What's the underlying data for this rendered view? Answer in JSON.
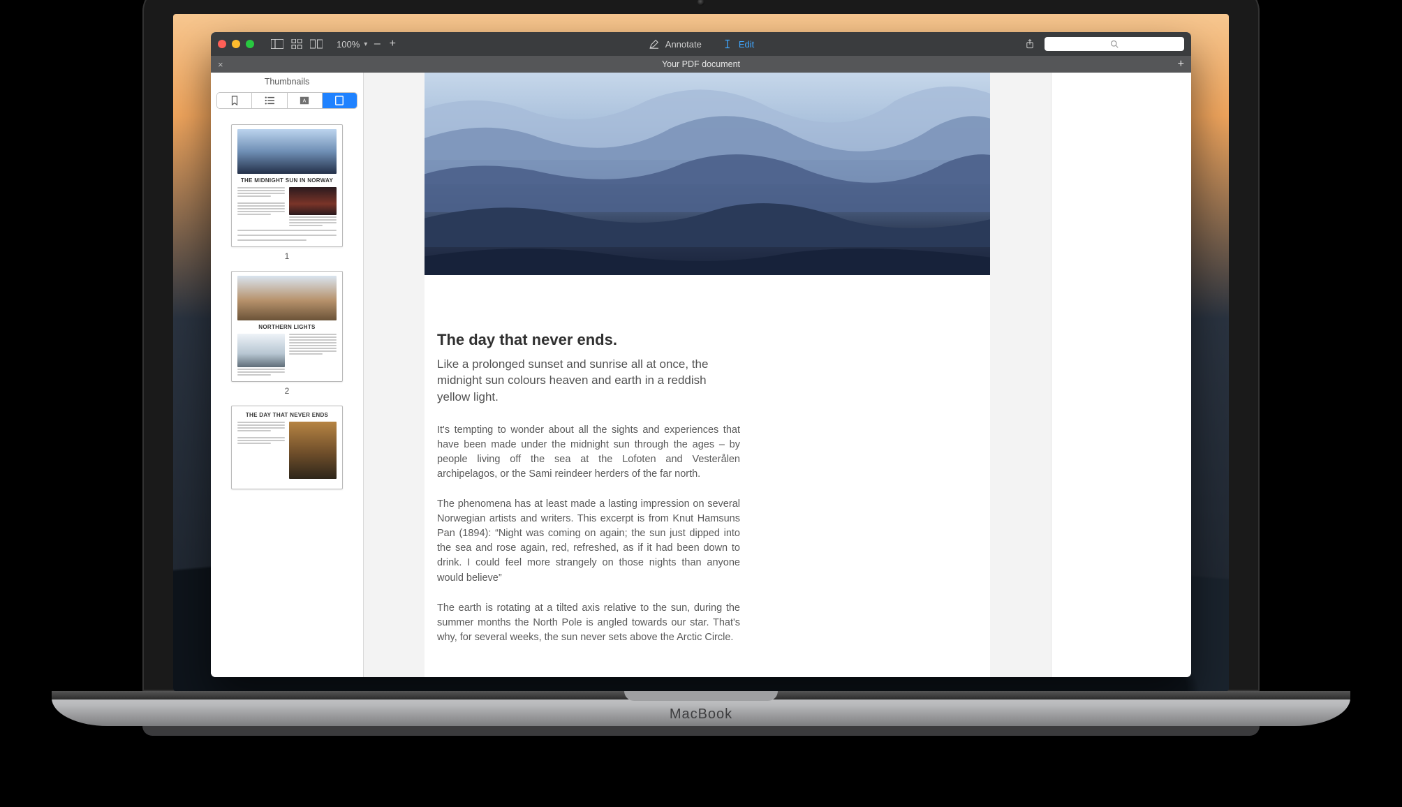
{
  "device": {
    "brand": "MacBook"
  },
  "toolbar": {
    "zoom_value": "100%",
    "minus": "–",
    "plus": "+",
    "annotate_label": "Annotate",
    "edit_label": "Edit",
    "search_placeholder": ""
  },
  "tab": {
    "title": "Your PDF document",
    "close": "×",
    "add": "+"
  },
  "sidebar": {
    "title": "Thumbnails",
    "pages": [
      {
        "number": "1",
        "title": "THE MIDNIGHT SUN IN NORWAY"
      },
      {
        "number": "2",
        "title": "NORTHERN LIGHTS"
      },
      {
        "number": "",
        "title": "THE DAY THAT NEVER ENDS"
      }
    ]
  },
  "document": {
    "heading": "The day that never ends.",
    "lead": "Like a prolonged sunset and sunrise all at once, the midnight sun colours heaven and earth in a reddish yellow light.",
    "paragraphs": [
      "It's tempting to wonder about all the sights and experiences that have been made under the midnight sun through the ages – by people living off the sea at the Lofoten and Vesterålen archipelagos, or the Sami reindeer herders of the far north.",
      "The phenomena has at least made a lasting impression on several Norwegian artists and writers. This excerpt is from Knut Hamsuns Pan (1894): “Night was coming on again; the sun just dipped into the sea and rose again, red, refreshed, as if it had been down to drink. I could feel more strangely on those nights than anyone would believe”",
      "The earth is rotating at a tilted axis relative to the sun, during the summer months the North Pole is angled towards our star. That's why, for several weeks, the sun never sets above the Arctic Circle."
    ]
  }
}
